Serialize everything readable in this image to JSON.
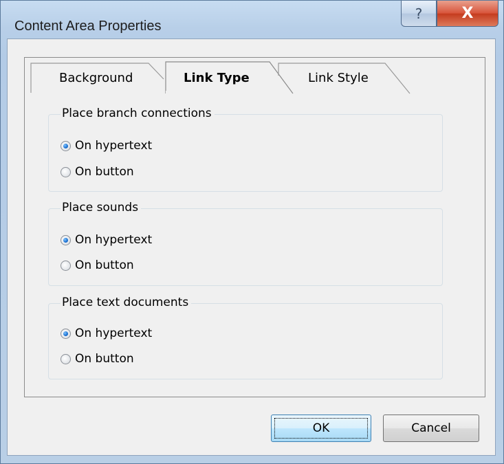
{
  "window": {
    "title": "Content Area Properties",
    "help_glyph": "?",
    "close_glyph": "X"
  },
  "tabs": [
    {
      "label": "Background",
      "active": false
    },
    {
      "label": "Link Type",
      "active": true
    },
    {
      "label": "Link Style",
      "active": false
    }
  ],
  "groups": [
    {
      "title": "Place branch connections",
      "options": [
        {
          "label": "On hypertext",
          "checked": true
        },
        {
          "label": "On button",
          "checked": false
        }
      ]
    },
    {
      "title": "Place sounds",
      "options": [
        {
          "label": "On hypertext",
          "checked": true
        },
        {
          "label": "On button",
          "checked": false
        }
      ]
    },
    {
      "title": "Place text documents",
      "options": [
        {
          "label": "On hypertext",
          "checked": true
        },
        {
          "label": "On button",
          "checked": false
        }
      ]
    }
  ],
  "buttons": {
    "ok": "OK",
    "cancel": "Cancel"
  }
}
